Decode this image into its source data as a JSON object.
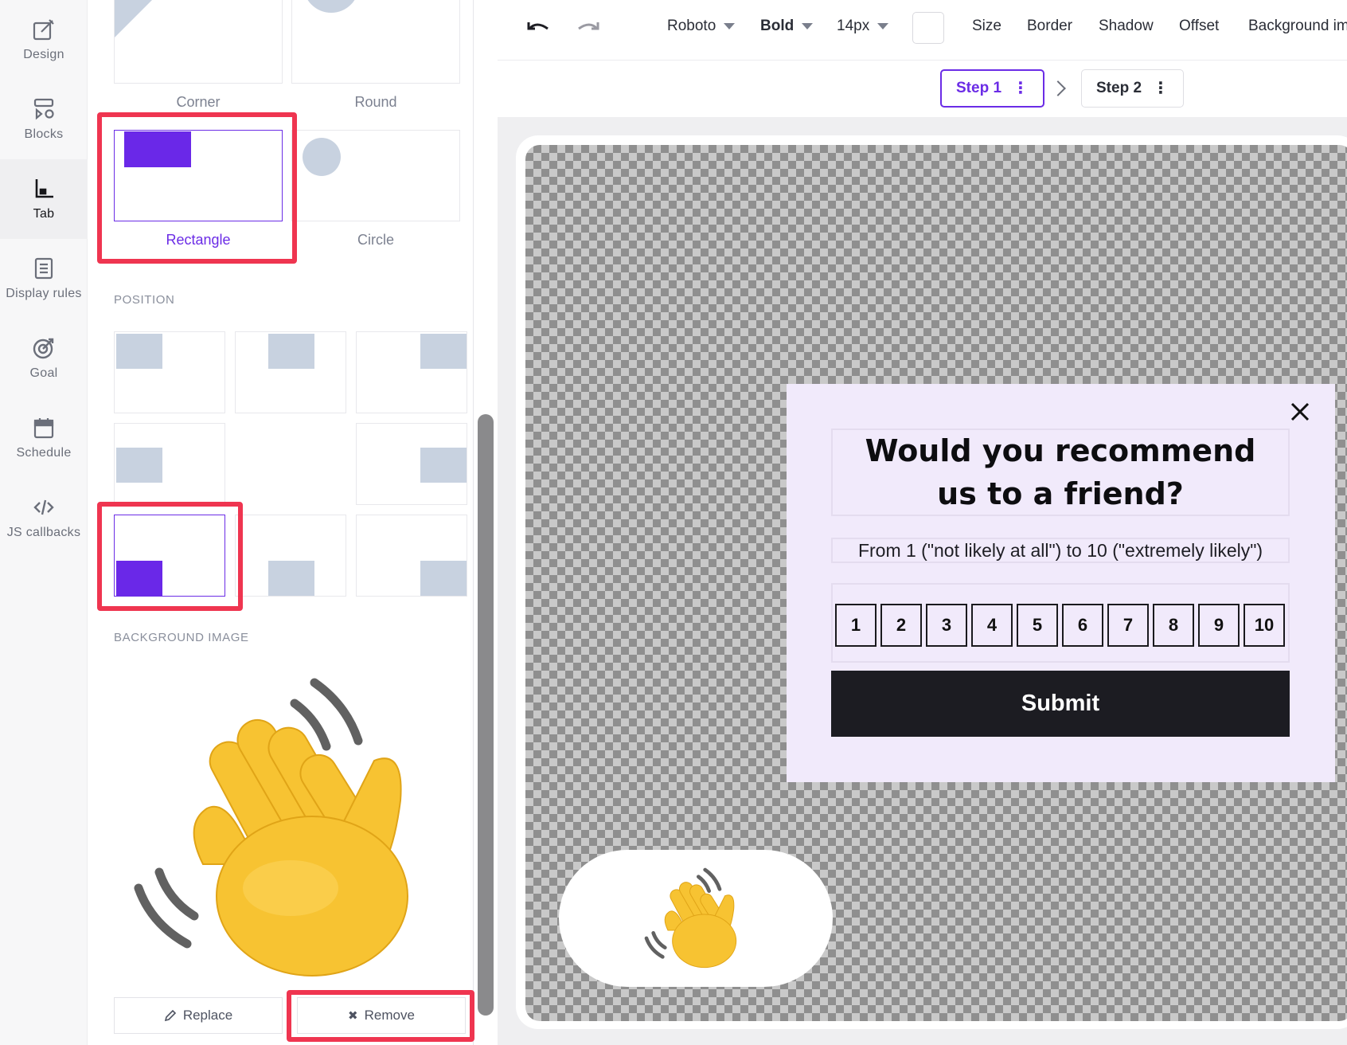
{
  "rail": {
    "items": [
      {
        "label": "Design",
        "icon": "design-icon"
      },
      {
        "label": "Blocks",
        "icon": "blocks-icon"
      },
      {
        "label": "Tab",
        "icon": "tab-icon",
        "active": true
      },
      {
        "label": "Display rules",
        "icon": "display-rules-icon"
      },
      {
        "label": "Goal",
        "icon": "goal-icon"
      },
      {
        "label": "Schedule",
        "icon": "calendar-icon"
      },
      {
        "label": "JS callbacks",
        "icon": "code-icon"
      }
    ]
  },
  "panel": {
    "shapes": [
      {
        "label": "Corner"
      },
      {
        "label": "Round"
      },
      {
        "label": "Rectangle",
        "selected": true
      },
      {
        "label": "Circle"
      }
    ],
    "position_heading": "POSITION",
    "position_selected": "bottom-left",
    "background_heading": "BACKGROUND IMAGE",
    "background_image": "waving-hand-emoji",
    "replace_label": "Replace",
    "remove_label": "Remove"
  },
  "toolbar": {
    "font": "Roboto",
    "weight": "Bold",
    "size": "14px",
    "items": [
      "Size",
      "Border",
      "Shadow",
      "Offset",
      "Background im"
    ]
  },
  "steps": [
    {
      "label": "Step 1",
      "active": true
    },
    {
      "label": "Step 2",
      "active": false
    }
  ],
  "popup": {
    "question_line1": "Would you recommend",
    "question_line2": "us to a friend?",
    "subtitle": "From 1 (\"not likely at all\") to 10 (\"extremely likely\")",
    "scale": [
      "1",
      "2",
      "3",
      "4",
      "5",
      "6",
      "7",
      "8",
      "9",
      "10"
    ],
    "submit_label": "Submit"
  },
  "colors": {
    "accent": "#6b2ce6",
    "highlight": "#ef3550",
    "popup_bg": "#f1eafb",
    "submit_bg": "#1c1c22"
  }
}
